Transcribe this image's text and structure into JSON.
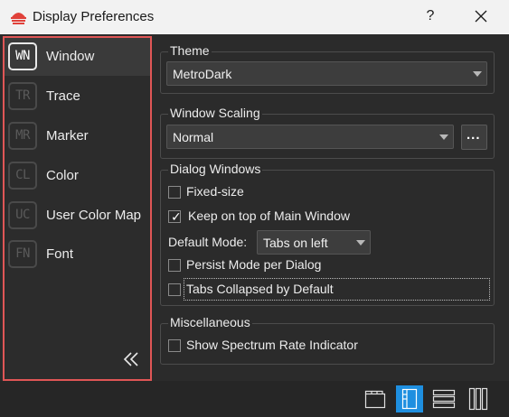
{
  "window": {
    "title": "Display Preferences",
    "help_label": "?"
  },
  "sidebar": {
    "items": [
      {
        "abbr": "WN",
        "label": "Window",
        "active": true
      },
      {
        "abbr": "TR",
        "label": "Trace",
        "active": false
      },
      {
        "abbr": "MR",
        "label": "Marker",
        "active": false
      },
      {
        "abbr": "CL",
        "label": "Color",
        "active": false
      },
      {
        "abbr": "UC",
        "label": "User Color Map",
        "active": false
      },
      {
        "abbr": "FN",
        "label": "Font",
        "active": false
      }
    ],
    "collapse_icon": "double-chevron-left-icon"
  },
  "theme": {
    "title": "Theme",
    "value": "MetroDark"
  },
  "scaling": {
    "title": "Window Scaling",
    "value": "Normal",
    "more_label": "..."
  },
  "dialog": {
    "title": "Dialog Windows",
    "fixed_size": {
      "label": "Fixed-size",
      "checked": false
    },
    "keep_on_top": {
      "label": "Keep on top of Main Window",
      "checked": true
    },
    "default_mode_label": "Default Mode:",
    "default_mode_value": "Tabs on left",
    "persist_mode": {
      "label": "Persist Mode per Dialog",
      "checked": false
    },
    "tabs_collapsed": {
      "label": "Tabs Collapsed by Default",
      "checked": false
    }
  },
  "misc": {
    "title": "Miscellaneous",
    "show_rate": {
      "label": "Show Spectrum Rate Indicator",
      "checked": false
    }
  },
  "bottom_bar": {
    "modes": [
      {
        "icon": "tabs-top-icon",
        "active": false
      },
      {
        "icon": "tabs-left-icon",
        "active": true
      },
      {
        "icon": "list-rows-icon",
        "active": false
      },
      {
        "icon": "columns-icon",
        "active": false
      }
    ]
  },
  "colors": {
    "accent": "#1e8fe0",
    "highlight_border": "#e05656",
    "background": "#2b2b2b"
  }
}
